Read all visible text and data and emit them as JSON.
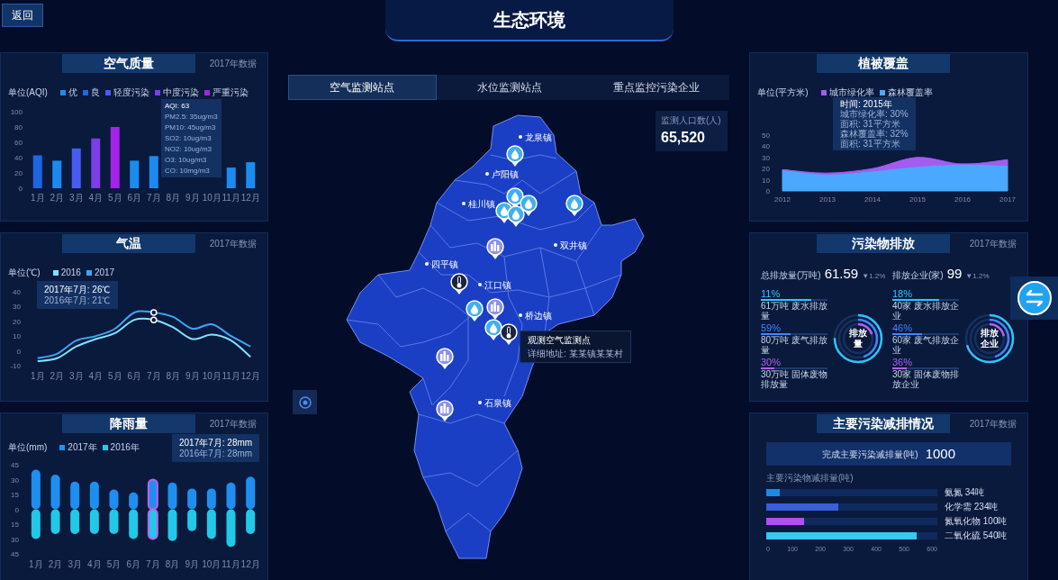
{
  "header": {
    "back_button": "返回",
    "title": "生态环境"
  },
  "air_quality": {
    "title": "空气质量",
    "date": "2017年数据",
    "unit": "单位(AQI)",
    "chart_data": {
      "type": "bar",
      "stacked": true,
      "categories": [
        "1月",
        "2月",
        "3月",
        "4月",
        "5月",
        "6月",
        "7月",
        "8月",
        "9月",
        "10月",
        "11月",
        "12月"
      ],
      "ylim": [
        0,
        100
      ],
      "yticks": [
        0,
        20,
        40,
        60,
        80,
        100
      ],
      "series": [
        {
          "name": "优",
          "color": "#1a8cf0",
          "values": [
            null,
            36,
            null,
            null,
            null,
            36,
            42,
            null,
            null,
            null,
            27,
            34
          ]
        },
        {
          "name": "良",
          "color": "#1f66e0",
          "values": [
            43,
            null,
            null,
            null,
            null,
            null,
            null,
            null,
            null,
            null,
            null,
            null
          ]
        },
        {
          "name": "轻度污染",
          "color": "#4a5cf0",
          "values": [
            null,
            null,
            52,
            null,
            null,
            null,
            null,
            null,
            null,
            null,
            null,
            null
          ]
        },
        {
          "name": "中度污染",
          "color": "#7a3fe6",
          "values": [
            null,
            null,
            null,
            65,
            null,
            null,
            null,
            null,
            null,
            null,
            null,
            null
          ]
        },
        {
          "name": "严重污染",
          "color": "#a224e8",
          "values": [
            null,
            null,
            null,
            null,
            80,
            null,
            null,
            null,
            null,
            null,
            null,
            null
          ]
        }
      ]
    },
    "tooltip": [
      "AQI: 63",
      "PM2.5: 35ug/m3",
      "PM10: 45ug/m3",
      "SO2: 10ug/m3",
      "NO2: 10ug/m3",
      "O3: 10ug/m3",
      "CO: 10mg/m3"
    ]
  },
  "temperature": {
    "title": "气温",
    "date": "2017年数据",
    "unit": "单位(℃)",
    "chart_data": {
      "type": "line",
      "categories": [
        "1月",
        "2月",
        "3月",
        "4月",
        "5月",
        "6月",
        "7月",
        "8月",
        "9月",
        "10月",
        "11月",
        "12月"
      ],
      "ylim": [
        -10,
        40
      ],
      "yticks": [
        -10,
        0,
        10,
        20,
        30,
        40
      ],
      "series": [
        {
          "name": "2016",
          "color": "#7fe3ff",
          "values": [
            -7,
            -5,
            3,
            8,
            12,
            21,
            21,
            16,
            8,
            11,
            7,
            -4
          ]
        },
        {
          "name": "2017",
          "color": "#3aa6f5",
          "values": [
            -5,
            -2,
            7,
            10,
            15,
            26,
            26,
            23,
            15,
            18,
            10,
            3
          ]
        }
      ]
    },
    "tooltip": [
      "2017年7月: 26℃",
      "2016年7月: 21℃"
    ]
  },
  "rainfall": {
    "title": "降雨量",
    "date": "2017年数据",
    "unit": "单位(mm)",
    "chart_data": {
      "type": "bar",
      "stacked": true,
      "categories": [
        "1月",
        "2月",
        "3月",
        "4月",
        "5月",
        "6月",
        "7月",
        "8月",
        "9月",
        "10月",
        "11月",
        "12月"
      ],
      "ylim": [
        -45,
        45
      ],
      "yticks": [
        {
          "value": 45,
          "label": "45"
        },
        {
          "value": 30,
          "label": "30"
        },
        {
          "value": 15,
          "label": "15"
        },
        {
          "value": 0,
          "label": "0"
        },
        {
          "value": -15,
          "label": "15"
        },
        {
          "value": -30,
          "label": "30"
        },
        {
          "value": -45,
          "label": "45"
        }
      ],
      "series": [
        {
          "name": "2017年",
          "color": "#1e8ff0",
          "values": [
            40,
            35,
            28,
            28,
            20,
            17,
            30,
            27,
            21,
            21,
            27,
            33
          ]
        },
        {
          "name": "2016年",
          "color": "#22c8e8",
          "values": [
            -30,
            -25,
            -25,
            -25,
            -25,
            -30,
            -30,
            -32,
            -22,
            -30,
            -38,
            -25
          ]
        }
      ]
    },
    "highlighted": [
      false,
      false,
      false,
      false,
      false,
      false,
      true,
      false,
      false,
      false,
      false,
      false
    ],
    "tooltip": [
      "2017年7月: 28mm",
      "2016年7月: 28mm"
    ]
  },
  "map": {
    "tabs": [
      {
        "label": "空气监测站点",
        "selected": true
      },
      {
        "label": "水位监测站点",
        "selected": false
      },
      {
        "label": "重点监控污染企业",
        "selected": false
      }
    ],
    "population_label": "监测人口数(人)",
    "population": "65,520",
    "towns": [
      "龙泉镇",
      "卢阳镇",
      "桂川镇",
      "双井镇",
      "四平镇",
      "江口镇",
      "桥边镇",
      "石泉镇"
    ],
    "tooltip": {
      "title": "观测空气监测点",
      "address": "详细地址: 某某镇某某村"
    }
  },
  "vegetation": {
    "title": "植被覆盖",
    "unit": "单位(平方米)",
    "chart_data": {
      "type": "area",
      "x": [
        "2012",
        "2013",
        "2014",
        "2015",
        "2016",
        "2017"
      ],
      "ylim": [
        0,
        50
      ],
      "yticks": [
        0,
        10,
        20,
        30,
        40,
        50
      ],
      "series": [
        {
          "name": "城市绿化率",
          "color": "#a45cf0",
          "values": [
            19,
            16,
            20,
            30,
            24,
            28
          ]
        },
        {
          "name": "森林覆盖率",
          "color": "#4aa8ff",
          "values": [
            19,
            15,
            18,
            22,
            24,
            23
          ]
        }
      ]
    },
    "tooltip": [
      "时间: 2015年",
      "城市绿化率: 30%",
      "面积: 31平方米",
      "森林覆盖率: 32%",
      "面积: 31平方米"
    ]
  },
  "emissions": {
    "title": "污染物排放",
    "date": "2017年数据",
    "groups": [
      {
        "label": "总排放量(万吨)",
        "value": "61.59",
        "change": "▼1.2%",
        "ring_label": "排放量",
        "items": [
          {
            "percent": "11%",
            "text": "61万吨 废水排放量",
            "level": 0.75,
            "color": "#2ec5ff"
          },
          {
            "percent": "59%",
            "text": "80万吨 废气排放量",
            "level": 0.45,
            "color": "#3f86ff"
          },
          {
            "percent": "30%",
            "text": "30万吨 固体废物排放量",
            "level": 0.2,
            "color": "#b060f0"
          }
        ]
      },
      {
        "label": "排放企业(家)",
        "value": "99",
        "change": "▼1.2%",
        "ring_label": "排放企业",
        "items": [
          {
            "percent": "18%",
            "text": "40家 废水排放企业",
            "level": 0.7,
            "color": "#2ec5ff"
          },
          {
            "percent": "46%",
            "text": "60家 废气排放企业",
            "level": 0.45,
            "color": "#3f86ff"
          },
          {
            "percent": "36%",
            "text": "30家 固体废物排放企业",
            "level": 0.22,
            "color": "#b060f0"
          }
        ]
      }
    ]
  },
  "reduction": {
    "title": "主要污染减排情况",
    "date": "2017年数据",
    "total_label": "完成主要污染减排量(吨)",
    "total": "1000",
    "chart_title": "主要污染物减排量(吨)",
    "bars": [
      {
        "label": "氨氮 34吨",
        "level": 0.08,
        "color": "#1e88e8"
      },
      {
        "label": "化学需 234吨",
        "level": 0.42,
        "color": "#3b5fd8"
      },
      {
        "label": "氮氧化物 100吨",
        "level": 0.22,
        "color": "#b050f0"
      },
      {
        "label": "二氧化硫 540吨",
        "level": 0.88,
        "color": "#38c8f0"
      }
    ],
    "ticks": [
      "0",
      "100",
      "200",
      "300",
      "400",
      "500",
      "600"
    ]
  }
}
